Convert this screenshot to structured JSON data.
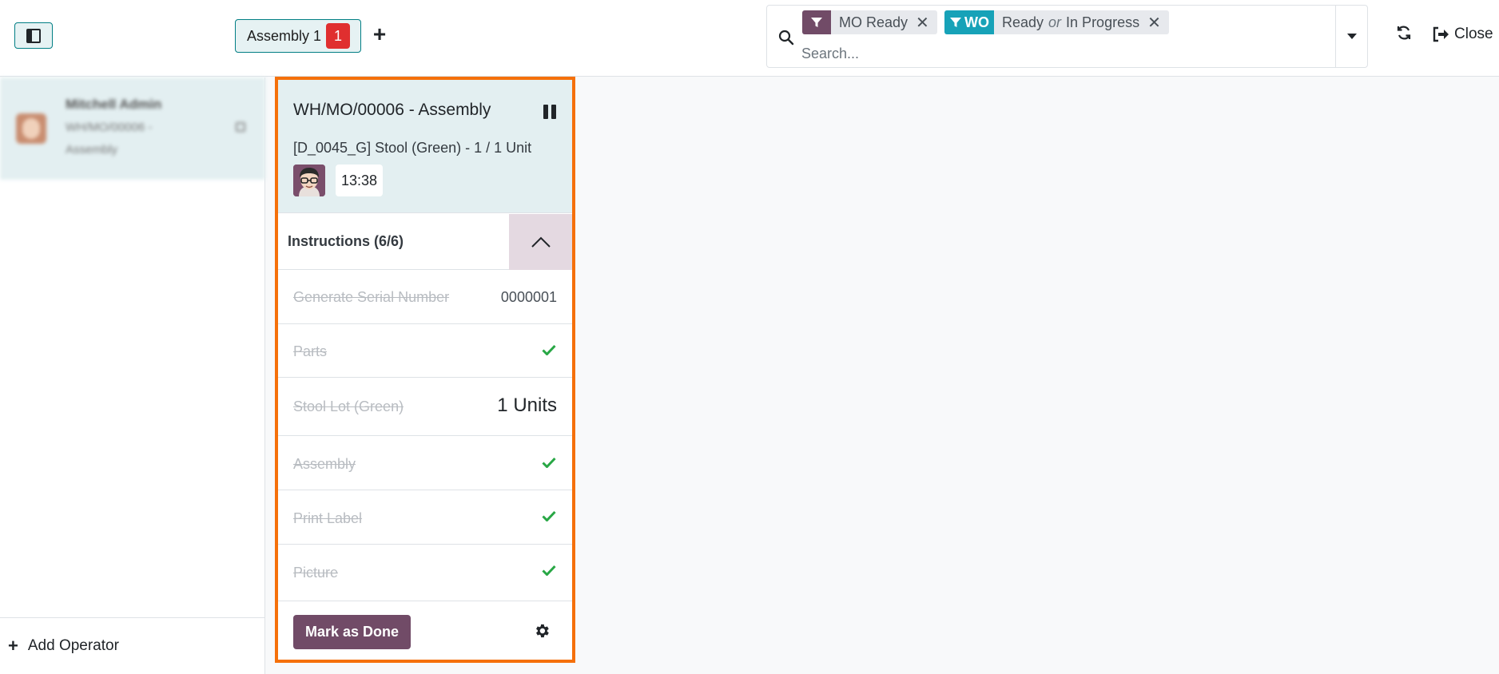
{
  "topbar": {
    "workcenter_tab": {
      "label": "Assembly 1",
      "count": "1"
    },
    "search": {
      "facets": [
        {
          "type": "",
          "values": [
            "MO Ready"
          ],
          "color": "#714b67"
        },
        {
          "type": "WO",
          "values": [
            "Ready",
            "In Progress"
          ],
          "joiner": "or",
          "color": "#17a2b8"
        }
      ],
      "placeholder": "Search..."
    },
    "close_label": "Close"
  },
  "operator_panel": {
    "operator": {
      "name": "Mitchell Admin",
      "mo": "WH/MO/00006 -",
      "wo": "Assembly"
    },
    "add_operator_label": "Add Operator"
  },
  "work_order": {
    "title": "WH/MO/00006 - Assembly",
    "product": "[D_0045_G] Stool (Green) - 1 / 1 Unit",
    "timer": "13:38",
    "instructions_title": "Instructions (6/6)",
    "steps": [
      {
        "title": "Generate Serial Number",
        "value": "0000001"
      },
      {
        "title": "Parts",
        "value": ""
      },
      {
        "title": "Stool Lot (Green)",
        "value": "1 Units"
      },
      {
        "title": "Assembly",
        "value": ""
      },
      {
        "title": "Print Label",
        "value": ""
      },
      {
        "title": "Picture",
        "value": ""
      }
    ],
    "mark_done_label": "Mark as Done"
  },
  "colors": {
    "primary": "#714b67",
    "accent": "#017e84",
    "card_border": "#f5700a",
    "success": "#28a745",
    "badge_red": "#e02f2f"
  }
}
